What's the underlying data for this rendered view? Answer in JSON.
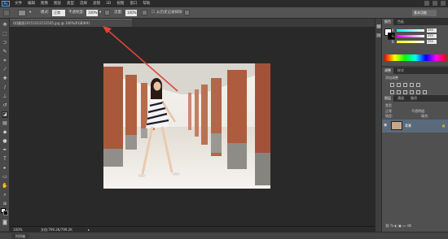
{
  "app": {
    "logo": "Ps"
  },
  "menu": [
    "文件",
    "编辑",
    "图像",
    "图层",
    "类型",
    "选择",
    "滤镜",
    "3D",
    "视图",
    "窗口",
    "帮助"
  ],
  "workspace_button": "基本功能",
  "options_bar": {
    "mode_label": "模式:",
    "mode_value": "正常",
    "opacity_label": "不透明度:",
    "opacity_value": "100%",
    "flow_label": "流量:",
    "flow_value": "100%",
    "sample_label": "从历史记录抹除"
  },
  "document": {
    "tab_title": "QQ截图20151012152505.jpg @ 100%(RGB/8#)",
    "zoom": "100%",
    "doc_size": "文档:799.2K/799.2K"
  },
  "panels": {
    "color_tabs": [
      "颜色",
      "色板"
    ],
    "color_channels": [
      {
        "label": "R",
        "value": "255"
      },
      {
        "label": "G",
        "value": "255"
      },
      {
        "label": "B",
        "value": "255"
      }
    ],
    "adjust_tabs": [
      "调整",
      "样式"
    ],
    "adjust_title": "添加调整",
    "layers_tabs": [
      "图层",
      "通道",
      "路径"
    ],
    "layers_kind": "类型",
    "layers_blend": "正常",
    "layers_opacity": "不透明度:",
    "layers_lock": "锁定:",
    "layers_fill": "填充:",
    "layer_name": "背景"
  },
  "bottom_tab": "时间轴",
  "colors": {
    "accent": "#4ea3ff",
    "arrow": "#e0443a"
  }
}
